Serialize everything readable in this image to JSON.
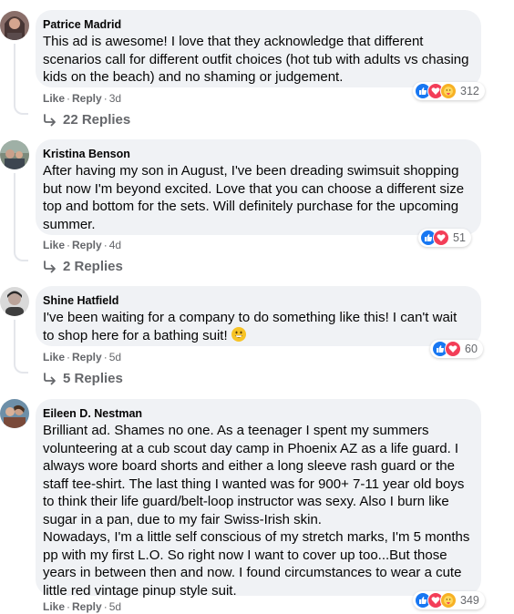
{
  "comments": [
    {
      "author": "Patrice Madrid",
      "text": "This ad is awesome! I love that they acknowledge that different scenarios call for different outfit choices (hot tub with adults vs chasing kids on the beach) and no shaming or judgement.",
      "like_label": "Like",
      "reply_label": "Reply",
      "time": "3d",
      "reaction_count": "312",
      "reactions": [
        "like",
        "love",
        "care"
      ],
      "replies_label": "22 Replies"
    },
    {
      "author": "Kristina Benson",
      "text": "After having my son in August, I've been dreading swimsuit shopping but now I'm beyond excited. Love that you can choose a different size top and bottom for the sets. Will definitely purchase for the upcoming summer.",
      "like_label": "Like",
      "reply_label": "Reply",
      "time": "4d",
      "reaction_count": "51",
      "reactions": [
        "like",
        "love"
      ],
      "replies_label": "2 Replies"
    },
    {
      "author": "Shine Hatfield",
      "text": "I've been waiting for a company to do something like this! I can't wait to shop here for a bathing suit!",
      "like_label": "Like",
      "reply_label": "Reply",
      "time": "5d",
      "reaction_count": "60",
      "reactions": [
        "like",
        "love"
      ],
      "replies_label": "5 Replies"
    },
    {
      "author": "Eileen D. Nestman",
      "text_para1": "Brilliant ad. Shames no one. As a teenager I spent my summers volunteering at a cub scout day camp in Phoenix AZ as a life guard. I always wore board shorts and either a long sleeve rash guard or the staff tee-shirt. The last thing I wanted was for 900+ 7-11 year old boys to think their life guard/belt-loop instructor was sexy. Also I burn like sugar in a pan, due to my fair Swiss-Irish skin.",
      "text_para2": "Nowadays, I'm a little self conscious of my stretch marks, I'm 5 months pp with my first L.O. So right now I want to cover up too...But those years in between then and now. I found circumstances to wear a cute little red vintage pinup style suit.",
      "like_label": "Like",
      "reply_label": "Reply",
      "time": "5d",
      "reaction_count": "349",
      "reactions": [
        "like",
        "love",
        "care"
      ]
    }
  ],
  "colors": {
    "bubble": "#f0f2f5",
    "meta_text": "#65676b",
    "like_blue": "#1877f2",
    "love_red": "#f33e58",
    "care_yellow": "#f7b125"
  }
}
